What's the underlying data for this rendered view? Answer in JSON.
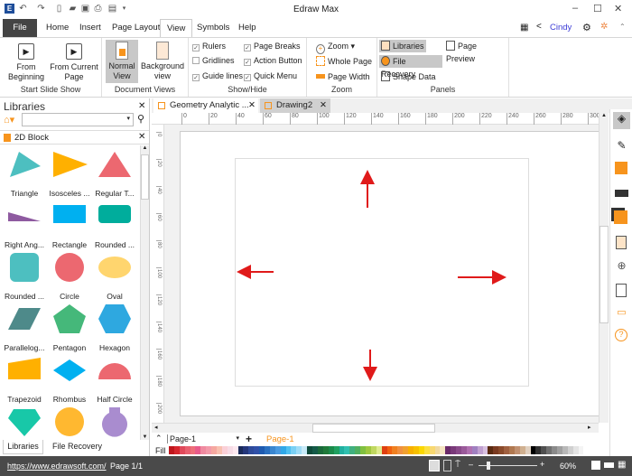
{
  "app": {
    "title": "Edraw Max"
  },
  "menu": {
    "tabs": [
      "File",
      "Home",
      "Insert",
      "Page Layout",
      "View",
      "Symbols",
      "Help"
    ],
    "active": "View",
    "user": "Cindy"
  },
  "ribbon": {
    "slideshow": {
      "from_beginning": [
        "From",
        "Beginning"
      ],
      "from_current": [
        "From Current",
        "Page"
      ],
      "label": "Start Slide Show"
    },
    "docviews": {
      "normal": [
        "Normal",
        "View"
      ],
      "background": [
        "Background",
        "view"
      ],
      "label": "Document Views"
    },
    "showhide": {
      "items": [
        {
          "label": "Rulers",
          "checked": true
        },
        {
          "label": "Gridlines",
          "checked": false
        },
        {
          "label": "Guide lines",
          "checked": true
        },
        {
          "label": "Page Breaks",
          "checked": true
        },
        {
          "label": "Action Button",
          "checked": true
        },
        {
          "label": "Quick Menu",
          "checked": true
        }
      ],
      "label": "Show/Hide"
    },
    "zoom": {
      "zoom": "Zoom",
      "whole_page": "Whole Page",
      "page_width": "Page Width",
      "label": "Zoom"
    },
    "panels": {
      "libraries": "Libraries",
      "file_recovery": "File Recovery",
      "shape_data": "Shape Data",
      "page_preview": "Page Preview",
      "label": "Panels"
    }
  },
  "library": {
    "title": "Libraries",
    "search_value": "",
    "category": "2D Block",
    "shapes": [
      "Triangle",
      "Isosceles ...",
      "Regular T...",
      "Right Ang...",
      "Rectangle",
      "Rounded ...",
      "Rounded ...",
      "Circle",
      "Oval",
      "Parallelog...",
      "Pentagon",
      "Hexagon",
      "Trapezoid",
      "Rhombus",
      "Half Circle",
      "",
      "",
      ""
    ],
    "bottom_tabs": [
      "Libraries",
      "File Recovery"
    ]
  },
  "doc_tabs": [
    {
      "label": "Geometry Analytic ...",
      "active": false
    },
    {
      "label": "Drawing2",
      "active": true
    }
  ],
  "rulers": {
    "h": [
      "0",
      "20",
      "40",
      "60",
      "80",
      "100",
      "120",
      "140",
      "160",
      "180",
      "200",
      "220",
      "240",
      "260",
      "280",
      "300"
    ],
    "v": [
      "0",
      "20",
      "40",
      "60",
      "80",
      "100",
      "120",
      "140",
      "160",
      "180",
      "200"
    ]
  },
  "pages": {
    "current": "Page-1",
    "tab": "Page-1",
    "fill_label": "Fill"
  },
  "palette": [
    "#c0161c",
    "#d7262e",
    "#e0495a",
    "#e86070",
    "#ee6e7a",
    "#e85b8a",
    "#f08aa0",
    "#f39aaa",
    "#f5a8a0",
    "#f8c0b0",
    "#fad0d8",
    "#f7dce6",
    "#fde8ef",
    "#1a2a5a",
    "#24367a",
    "#2e4a9a",
    "#3050a8",
    "#1e5ab0",
    "#2a70c0",
    "#3a86d0",
    "#4a9ae0",
    "#30a8e8",
    "#50c0f0",
    "#7ad0f4",
    "#a0dcf6",
    "#c8eaf8",
    "#0e4a3a",
    "#145a48",
    "#1a6a3a",
    "#207a3a",
    "#1a8a4a",
    "#20a060",
    "#20b0a0",
    "#30c0b0",
    "#40b080",
    "#50b060",
    "#80c040",
    "#a0c840",
    "#c0d860",
    "#e0ec90",
    "#e04010",
    "#f06010",
    "#f08020",
    "#f09040",
    "#f0a030",
    "#f8b000",
    "#f8c000",
    "#fbd800",
    "#fce040",
    "#f8d870",
    "#f0d8a0",
    "#f4e4c0",
    "#6a2a6a",
    "#7a3a7a",
    "#8a4a8a",
    "#9a5a9a",
    "#b070b0",
    "#a080c0",
    "#c0a0d0",
    "#d8c0e0",
    "#5a2a10",
    "#7a3a20",
    "#8a4a2a",
    "#a06040",
    "#b07850",
    "#c09070",
    "#d0b090",
    "#e0d0c0",
    "#000000",
    "#303030",
    "#505050",
    "#707070",
    "#8a8a8a",
    "#a0a0a0",
    "#b8b8b8",
    "#d0d0d0",
    "#e4e4e4",
    "#f4f4f4"
  ],
  "status": {
    "url": "https://www.edrawsoft.com/",
    "page": "Page 1/1",
    "zoom": "60%"
  },
  "colors": {
    "arrow": "#e01a1a",
    "accent": "#f7941d"
  }
}
